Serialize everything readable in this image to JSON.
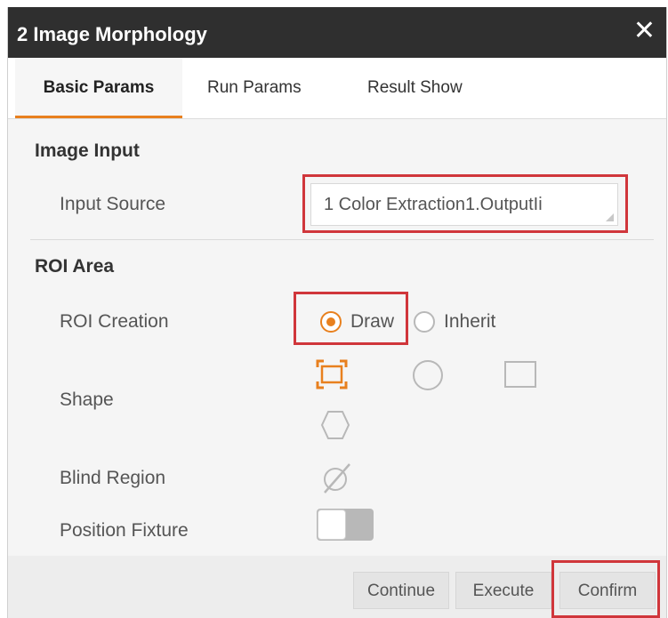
{
  "window": {
    "title": "2 Image Morphology",
    "close_glyph": "✕"
  },
  "tabs": [
    {
      "label": "Basic Params",
      "active": true
    },
    {
      "label": "Run Params",
      "active": false
    },
    {
      "label": "Result Show",
      "active": false
    }
  ],
  "image_input": {
    "section_title": "Image Input",
    "input_source_label": "Input Source",
    "input_source_value": "1 Color Extraction1.OutputIi"
  },
  "roi_area": {
    "section_title": "ROI Area",
    "roi_creation_label": "ROI Creation",
    "options": [
      {
        "label": "Draw",
        "selected": true
      },
      {
        "label": "Inherit",
        "selected": false
      }
    ],
    "shape_label": "Shape",
    "shapes": [
      "rectangle-roi-icon",
      "circle-icon",
      "square-icon",
      "hexagon-icon"
    ],
    "selected_shape": "rectangle-roi-icon",
    "blind_region_label": "Blind Region",
    "blind_region_icon": "no-mask-icon",
    "position_fixture_label": "Position Fixture",
    "position_fixture_enabled": false
  },
  "footer": {
    "continue_label": "Continue",
    "execute_label": "Execute",
    "confirm_label": "Confirm"
  },
  "colors": {
    "accent": "#e8801e",
    "highlight": "#d0363b",
    "titlebar": "#2f2f2f"
  }
}
